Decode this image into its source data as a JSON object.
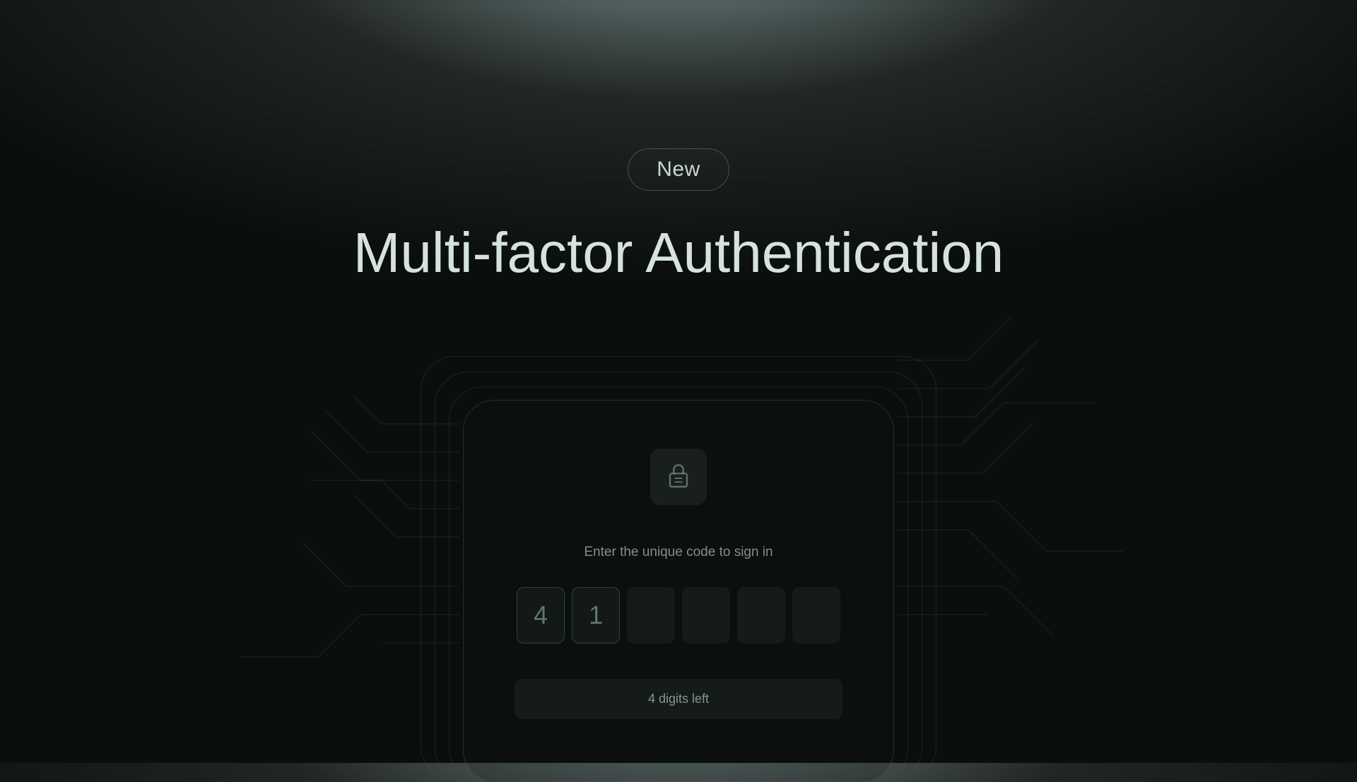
{
  "badge": {
    "label": "New"
  },
  "page": {
    "title": "Multi-factor Authentication"
  },
  "auth": {
    "instruction": "Enter the unique code to sign in",
    "digits": [
      "4",
      "1",
      "",
      "",
      "",
      ""
    ],
    "status": "4 digits left"
  },
  "icons": {
    "lock": "lock"
  }
}
